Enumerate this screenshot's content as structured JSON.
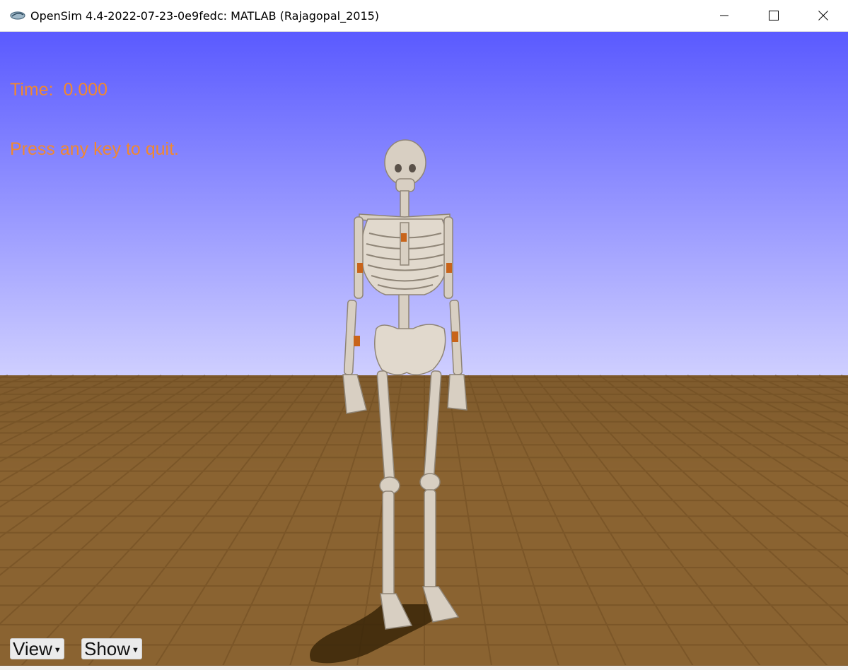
{
  "window": {
    "title": "OpenSim 4.4-2022-07-23-0e9fedc: MATLAB (Rajagopal_2015)",
    "controls": {
      "minimize": "minimize-icon",
      "maximize": "maximize-icon",
      "close": "close-icon"
    }
  },
  "hud": {
    "time_label": "Time:  0.000",
    "quit_hint": "Press any key to quit."
  },
  "menus": {
    "view_label": "View",
    "show_label": "Show"
  },
  "scene": {
    "sky_top_color": "#5a5aff",
    "sky_bottom_color": "#cfcfff",
    "floor_color": "#8a6331",
    "bone_color": "#d8cfc2",
    "muscle_marker_color": "#c8641a",
    "hud_text_color": "#f08830"
  }
}
